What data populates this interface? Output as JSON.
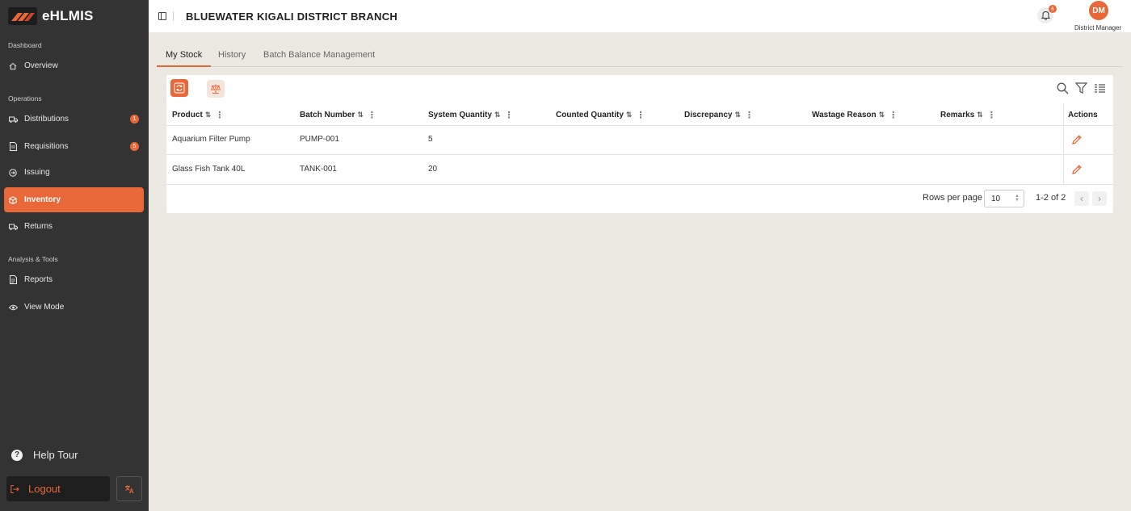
{
  "app": {
    "name": "eHLMIS"
  },
  "sidebar": {
    "sections": {
      "dashboard": "Dashboard",
      "operations": "Operations",
      "analysis": "Analysis & Tools"
    },
    "items": [
      {
        "label": "Overview",
        "icon": "home-icon"
      },
      {
        "label": "Distributions",
        "icon": "truck-icon",
        "badge": "1"
      },
      {
        "label": "Requisitions",
        "icon": "document-icon",
        "badge": "5"
      },
      {
        "label": "Issuing",
        "icon": "dispatch-icon"
      },
      {
        "label": "Inventory",
        "icon": "box-icon",
        "active": true
      },
      {
        "label": "Returns",
        "icon": "return-truck-icon"
      },
      {
        "label": "Reports",
        "icon": "report-icon"
      },
      {
        "label": "View Mode",
        "icon": "eye-icon"
      }
    ],
    "help_tour": "Help Tour",
    "logout": "Logout"
  },
  "header": {
    "title": "BLUEWATER KIGALI DISTRICT BRANCH",
    "notifications_count": "6",
    "avatar_initials": "DM",
    "user_role": "District Manager"
  },
  "tabs": [
    {
      "label": "My Stock",
      "active": true
    },
    {
      "label": "History"
    },
    {
      "label": "Batch Balance Management"
    }
  ],
  "table": {
    "columns": [
      "Product",
      "Batch Number",
      "System Quantity",
      "Counted Quantity",
      "Discrepancy",
      "Wastage Reason",
      "Remarks",
      "Actions"
    ],
    "rows": [
      {
        "product": "Aquarium Filter Pump",
        "batch_number": "PUMP-001",
        "system_quantity": "5",
        "counted_quantity": "",
        "discrepancy": "",
        "wastage_reason": "",
        "remarks": ""
      },
      {
        "product": "Glass Fish Tank 40L",
        "batch_number": "TANK-001",
        "system_quantity": "20",
        "counted_quantity": "",
        "discrepancy": "",
        "wastage_reason": "",
        "remarks": ""
      }
    ]
  },
  "pagination": {
    "rows_per_page_label": "Rows per page",
    "rows_per_page_value": "10",
    "range_text": "1-2 of 2"
  },
  "colors": {
    "accent": "#e8683a",
    "sidebar_bg": "#333333",
    "page_bg": "#ece9e2"
  }
}
